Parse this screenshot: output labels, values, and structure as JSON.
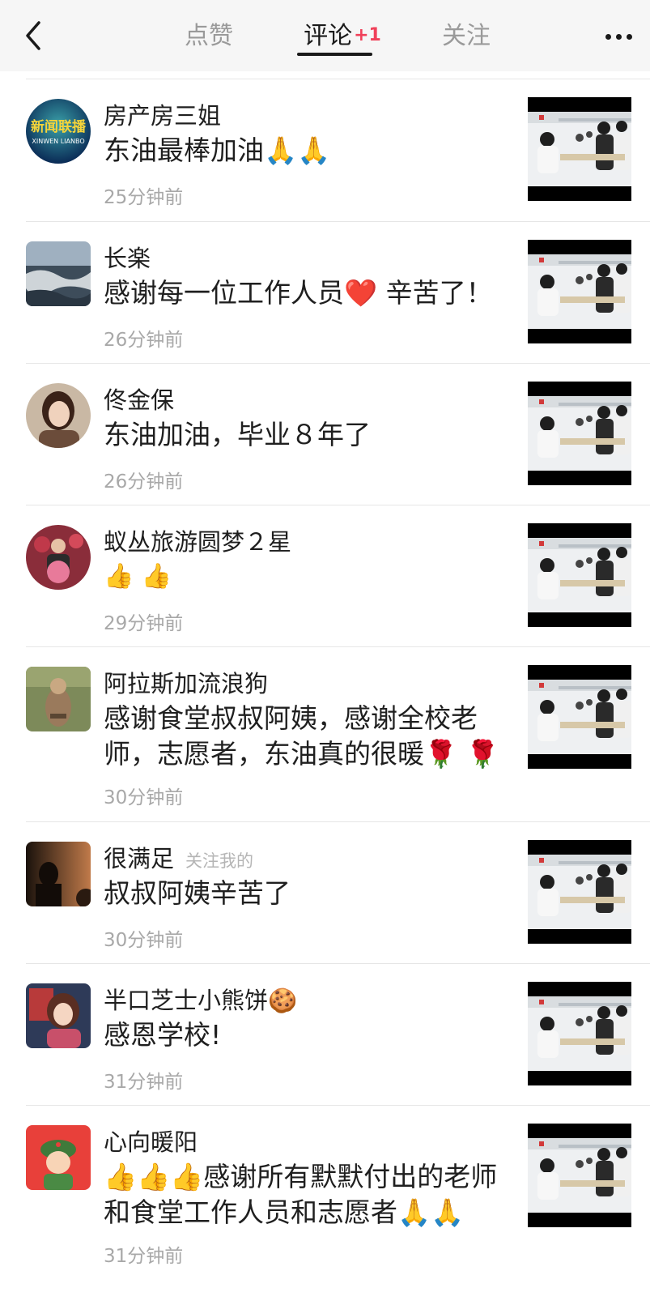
{
  "header": {
    "tabs": {
      "likes": "点赞",
      "comments": "评论",
      "comments_badge": "+1",
      "follows": "关注"
    }
  },
  "colors": {
    "badge": "#f0415a",
    "time": "#a8a8a8",
    "separator": "#e6e6e6"
  },
  "comments": [
    {
      "user": "房产房三姐",
      "text": "东油最棒加油🙏🙏",
      "time": "25分钟前",
      "avatar_text": "新闻联播",
      "avatar_sub": "XINWEN LIANBO"
    },
    {
      "user": "长楽",
      "text": "感谢每一位工作人员❤️ 辛苦了！",
      "time": "26分钟前"
    },
    {
      "user": "佟金保",
      "text": "东油加油，毕业８年了",
      "time": "26分钟前"
    },
    {
      "user": "蚁丛旅游圆梦２星",
      "text": "👍 👍",
      "time": "29分钟前"
    },
    {
      "user": "阿拉斯加流浪狗",
      "text": "感谢食堂叔叔阿姨，感谢全校老师，志愿者，东油真的很暖🌹 🌹",
      "time": "30分钟前"
    },
    {
      "user": "很满足",
      "tag": "关注我的",
      "text": "叔叔阿姨辛苦了",
      "time": "30分钟前"
    },
    {
      "user": "半口芝士小熊饼🍪",
      "text": "感恩学校!",
      "time": "31分钟前"
    },
    {
      "user": "心向暖阳",
      "text": "👍👍👍感谢所有默默付出的老师和食堂工作人员和志愿者🙏🙏",
      "time": "31分钟前"
    }
  ]
}
